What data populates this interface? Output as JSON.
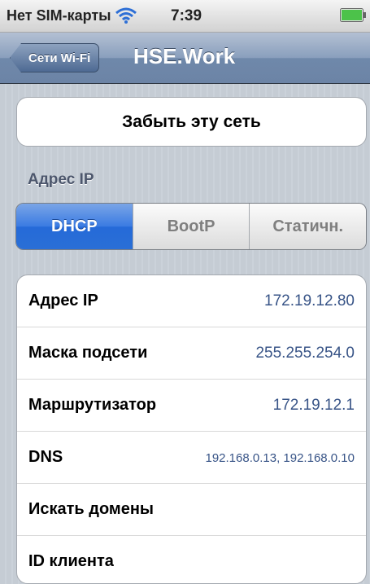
{
  "status_bar": {
    "carrier": "Нет SIM-карты",
    "time": "7:39",
    "icons": [
      "wifi-icon",
      "battery-icon"
    ]
  },
  "nav": {
    "back_label": "Сети Wi-Fi",
    "title": "HSE.Work"
  },
  "forget_button": "Забыть эту сеть",
  "ip_section_label": "Адрес IP",
  "segments": [
    "DHCP",
    "BootP",
    "Статичн."
  ],
  "selected_segment": "DHCP",
  "rows": [
    {
      "label": "Адрес IP",
      "value": "172.19.12.80"
    },
    {
      "label": "Маска подсети",
      "value": "255.255.254.0"
    },
    {
      "label": "Маршрутизатор",
      "value": "172.19.12.1"
    },
    {
      "label": "DNS",
      "value": "192.168.0.13, 192.168.0.10"
    },
    {
      "label": "Искать домены",
      "value": ""
    },
    {
      "label": "ID клиента",
      "value": ""
    }
  ],
  "colors": {
    "nav_bar": "#6f88aa",
    "segment_selected": "#2a6fd6",
    "value_text": "#385487",
    "background": "#c5ccd4"
  }
}
